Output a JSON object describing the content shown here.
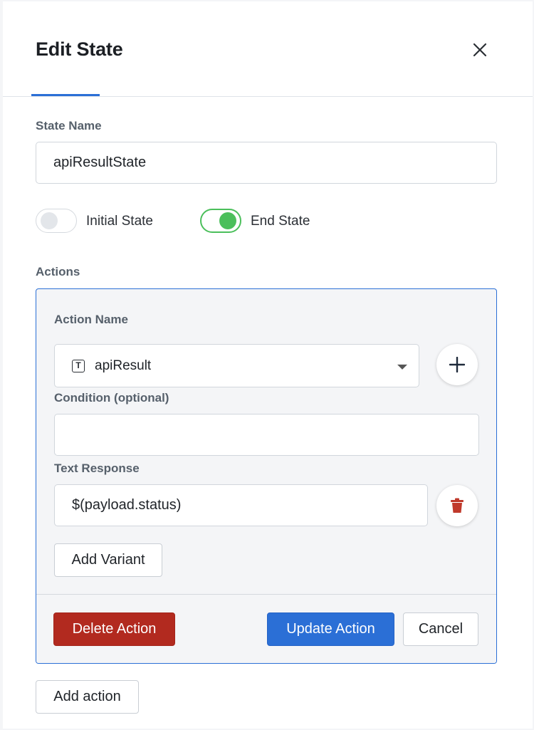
{
  "header": {
    "title": "Edit State"
  },
  "state_name": {
    "label": "State Name",
    "value": "apiResultState"
  },
  "toggles": {
    "initial_state": {
      "label": "Initial State",
      "checked": false
    },
    "end_state": {
      "label": "End State",
      "checked": true
    }
  },
  "actions": {
    "label": "Actions",
    "action_name": {
      "label": "Action Name",
      "selected": "apiResult",
      "type_icon": "T"
    },
    "condition": {
      "label": "Condition (optional)",
      "value": ""
    },
    "text_response": {
      "label": "Text Response",
      "value": "$(payload.status)"
    },
    "add_variant_label": "Add Variant",
    "delete_action_label": "Delete Action",
    "update_action_label": "Update Action",
    "cancel_label": "Cancel"
  },
  "add_action_label": "Add action",
  "icons": {
    "close": "close-icon",
    "add": "plus-icon",
    "delete": "trash-icon",
    "dropdown": "chevron-down-icon"
  },
  "colors": {
    "accent": "#2b6fd6",
    "danger": "#b22a1f",
    "toggle_on": "#4bbf5b"
  }
}
